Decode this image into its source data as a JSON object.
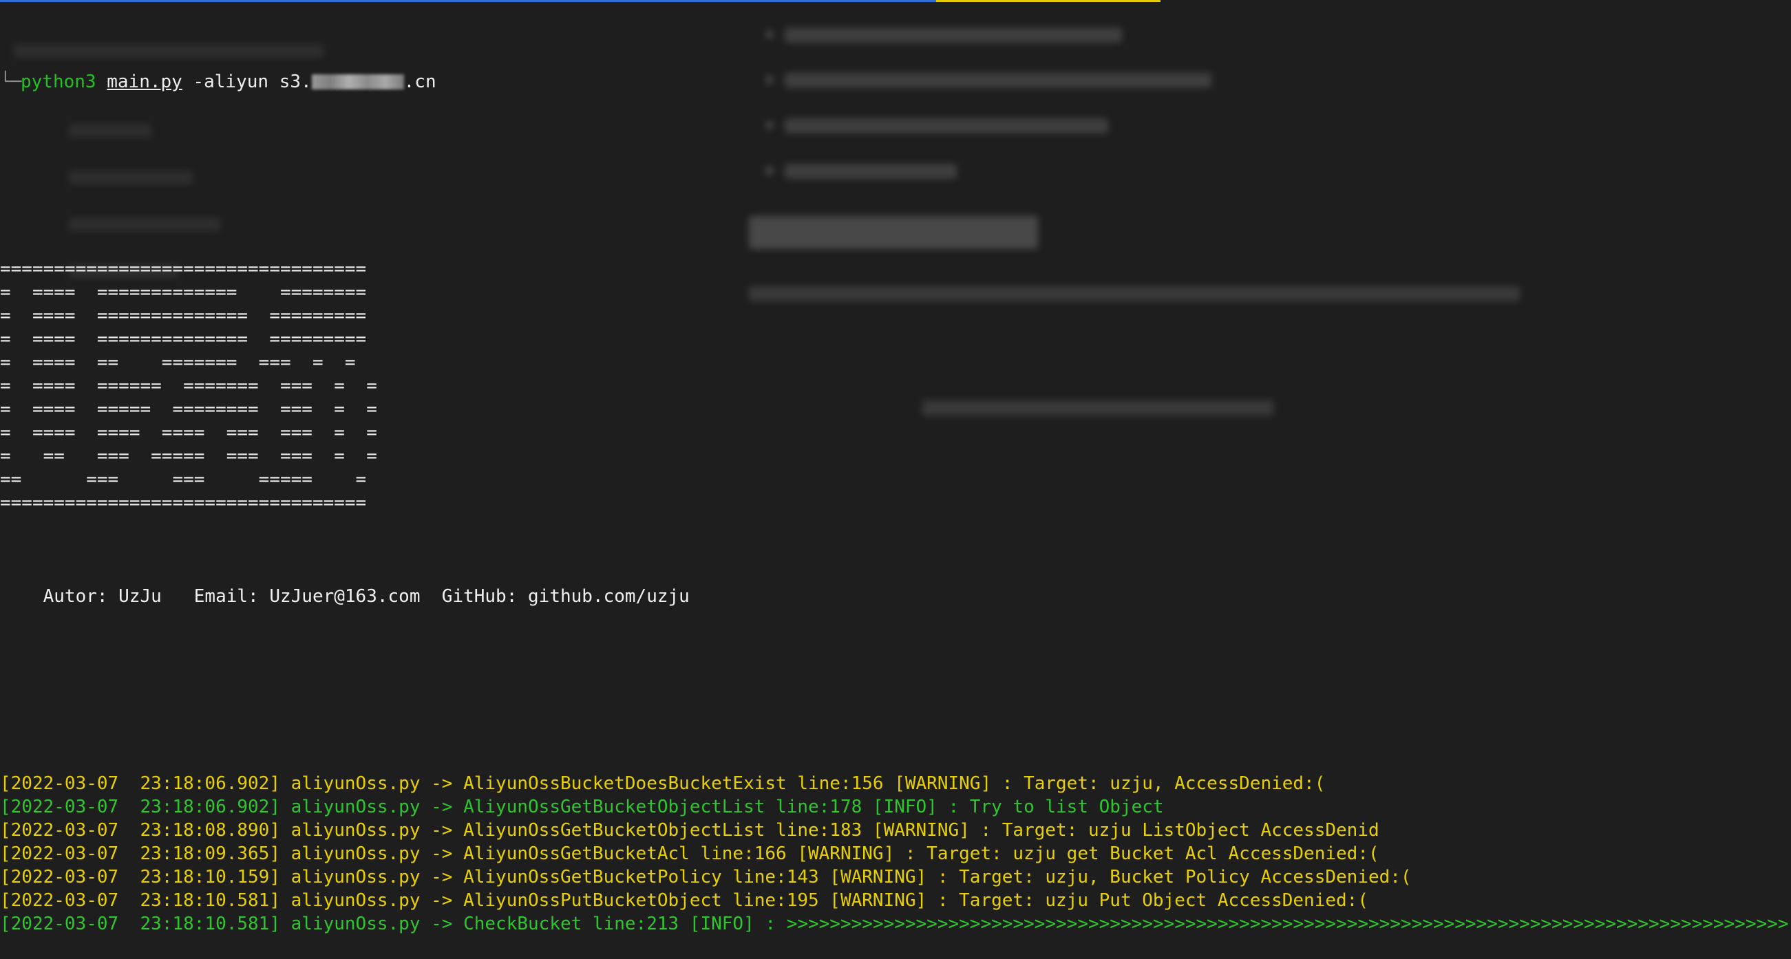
{
  "terminal": {
    "command": {
      "program": "python3",
      "script": "main.py",
      "args": "-aliyun s3.",
      "target_suffix": ".cn"
    },
    "banner_lines": [
      "==================================",
      "=  ====  =============    ========",
      "=  ====  ==============  =========",
      "=  ====  ==============  =========",
      "=  ====  ==    =======  ===  =  =",
      "=  ====  ======  =======  ===  =  =",
      "=  ====  =====  ========  ===  =  =",
      "=  ====  ====  ====  ===  ===  =  =",
      "=   ==   ===  =====  ===  ===  =  =",
      "==      ===     ===     =====    =",
      "=================================="
    ],
    "author_line": "    Autor: UzJu   Email: UzJuer@163.com  GitHub: github.com/uzju",
    "log_lines": [
      {
        "text": "[2022-03-07  23:18:06.902] aliyunOss.py -> AliyunOssBucketDoesBucketExist line:156 [WARNING] : Target: uzju, AccessDenied:(",
        "level": "warning"
      },
      {
        "text": "[2022-03-07  23:18:06.902] aliyunOss.py -> AliyunOssGetBucketObjectList line:178 [INFO] : Try to list Object",
        "level": "info"
      },
      {
        "text": "[2022-03-07  23:18:08.890] aliyunOss.py -> AliyunOssGetBucketObjectList line:183 [WARNING] : Target: uzju ListObject AccessDenid",
        "level": "warning"
      },
      {
        "text": "[2022-03-07  23:18:09.365] aliyunOss.py -> AliyunOssGetBucketAcl line:166 [WARNING] : Target: uzju get Bucket Acl AccessDenied:(",
        "level": "warning"
      },
      {
        "text": "[2022-03-07  23:18:10.159] aliyunOss.py -> AliyunOssGetBucketPolicy line:143 [WARNING] : Target: uzju, Bucket Policy AccessDenied:(",
        "level": "warning"
      },
      {
        "text": "[2022-03-07  23:18:10.581] aliyunOss.py -> AliyunOssPutBucketObject line:195 [WARNING] : Target: uzju Put Object AccessDenied:(",
        "level": "warning"
      },
      {
        "text": "[2022-03-07  23:18:10.581] aliyunOss.py -> CheckBucket line:213 [INFO] : >>>>>>>>>>>>>>>>>>>>>>>>>>>>>>>>>>>>>>>>>>>>>>>>>>>>>>>>>>>>>>>>>>>>>>>>>>>>>>>>>>>>>>>>>>>>>",
        "level": "info"
      }
    ]
  },
  "colors": {
    "background": "#1e1e1e",
    "warning": "#e8d000",
    "info": "#2ec52e",
    "command": "#23c023",
    "progress_blue": "#2f6fd6",
    "progress_yellow": "#e3c800"
  }
}
